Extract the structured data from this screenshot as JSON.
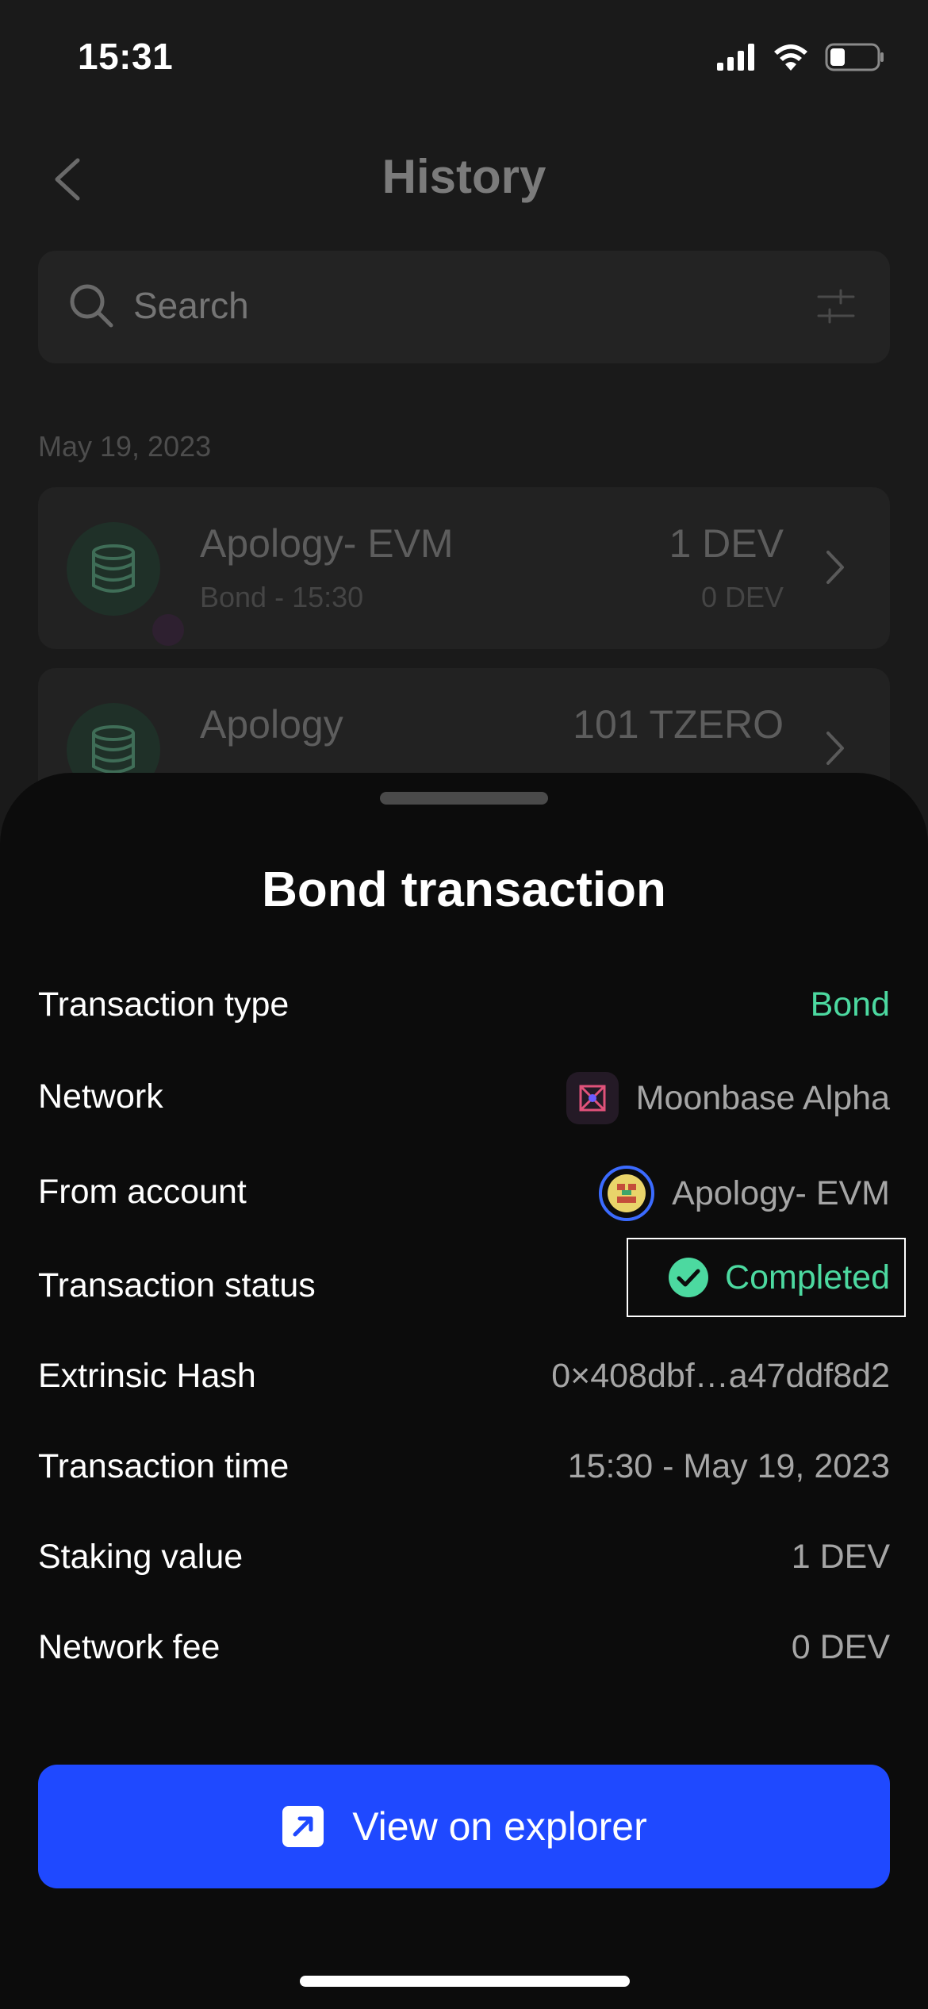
{
  "status_bar": {
    "time": "15:31"
  },
  "header": {
    "title": "History"
  },
  "search": {
    "placeholder": "Search"
  },
  "history": {
    "date": "May 19, 2023",
    "items": [
      {
        "name": "Apology- EVM",
        "sub": "Bond - 15:30",
        "amount": "1 DEV",
        "fee": "0 DEV"
      },
      {
        "name": "Apology",
        "amount": "101 TZERO"
      }
    ]
  },
  "sheet": {
    "title": "Bond transaction",
    "rows": [
      {
        "label": "Transaction type",
        "value": "Bond"
      },
      {
        "label": "Network",
        "value": "Moonbase Alpha"
      },
      {
        "label": "From account",
        "value": "Apology- EVM"
      },
      {
        "label": "Transaction status",
        "value": "Completed"
      },
      {
        "label": "Extrinsic Hash",
        "value": "0×408dbf…a47ddf8d2"
      },
      {
        "label": "Transaction time",
        "value": "15:30 - May 19, 2023"
      },
      {
        "label": "Staking value",
        "value": "1 DEV"
      },
      {
        "label": "Network fee",
        "value": "0 DEV"
      }
    ],
    "button_label": "View on explorer"
  },
  "colors": {
    "accent_green": "#4cd9a0",
    "button_blue": "#1f49ff",
    "account_ring": "#3b6bff"
  },
  "icons": [
    "back-icon",
    "search-icon",
    "filter-icon",
    "database-icon",
    "chevron-right-icon",
    "check-circle-icon",
    "external-link-icon",
    "signal-icon",
    "wifi-icon",
    "battery-icon"
  ]
}
